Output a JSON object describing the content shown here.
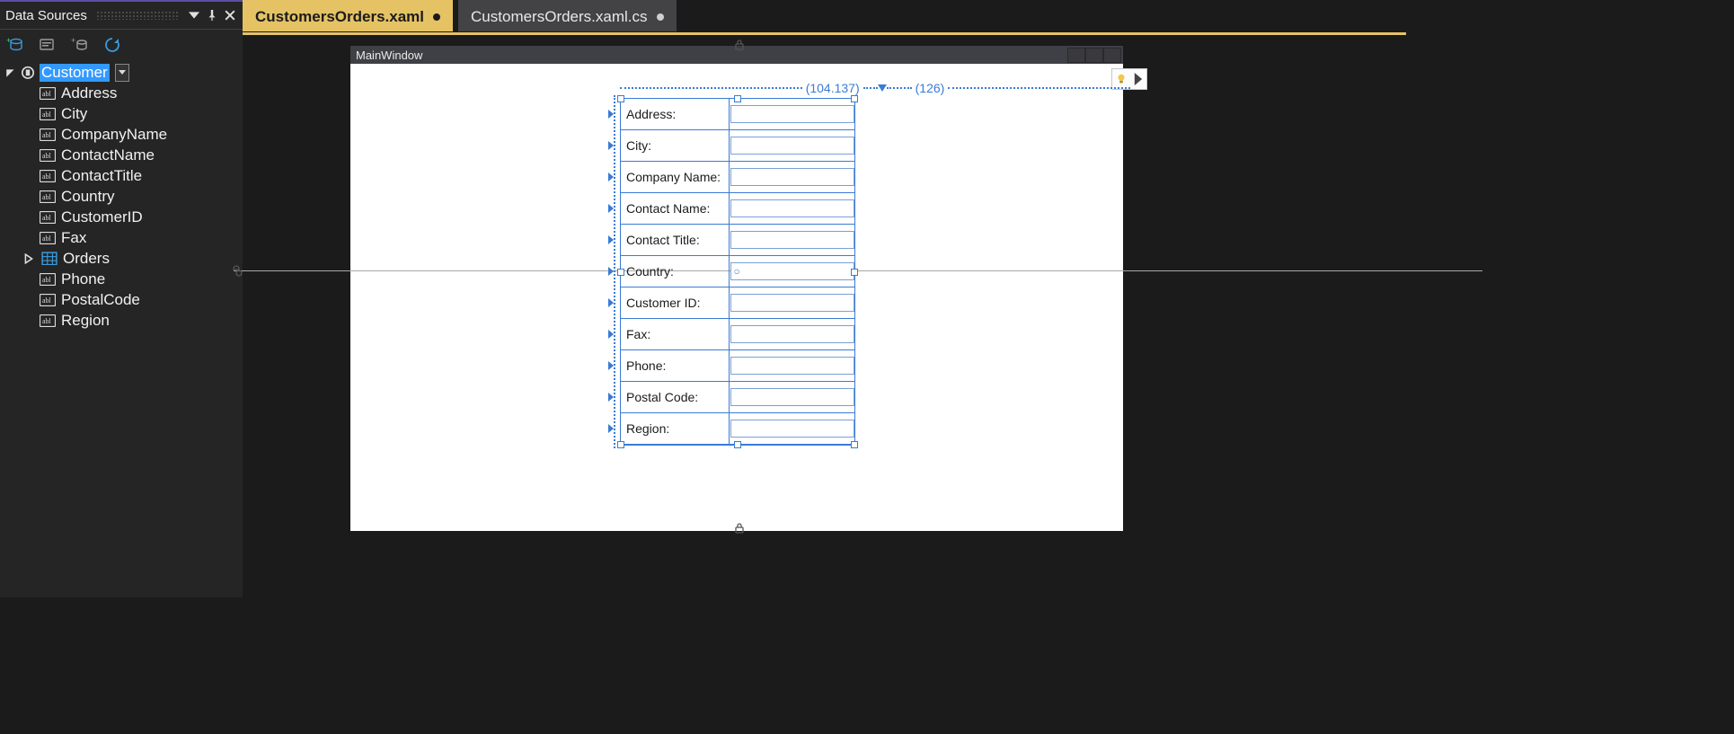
{
  "sidebar": {
    "title": "Data Sources",
    "toolbar": [
      "add-new-source",
      "edit",
      "add-query",
      "refresh"
    ],
    "root": {
      "label": "Customer",
      "children": [
        {
          "kind": "field",
          "label": "Address"
        },
        {
          "kind": "field",
          "label": "City"
        },
        {
          "kind": "field",
          "label": "CompanyName"
        },
        {
          "kind": "field",
          "label": "ContactName"
        },
        {
          "kind": "field",
          "label": "ContactTitle"
        },
        {
          "kind": "field",
          "label": "Country"
        },
        {
          "kind": "field",
          "label": "CustomerID"
        },
        {
          "kind": "field",
          "label": "Fax"
        },
        {
          "kind": "grid",
          "label": "Orders",
          "expandable": true
        },
        {
          "kind": "field",
          "label": "Phone"
        },
        {
          "kind": "field",
          "label": "PostalCode"
        },
        {
          "kind": "field",
          "label": "Region"
        }
      ]
    }
  },
  "tabs": [
    {
      "label": "CustomersOrders.xaml",
      "active": true,
      "dirty": true
    },
    {
      "label": "CustomersOrders.xaml.cs",
      "active": false,
      "dirty": true
    }
  ],
  "designer": {
    "windowTitle": "MainWindow",
    "ruler": {
      "col0": "(104.137)",
      "col1": "(126)"
    },
    "formRows": [
      {
        "label": "Address:",
        "value": ""
      },
      {
        "label": "City:",
        "value": ""
      },
      {
        "label": "Company Name:",
        "value": ""
      },
      {
        "label": "Contact Name:",
        "value": ""
      },
      {
        "label": "Contact Title:",
        "value": ""
      },
      {
        "label": "Country:",
        "value": "○"
      },
      {
        "label": "Customer ID:",
        "value": ""
      },
      {
        "label": "Fax:",
        "value": ""
      },
      {
        "label": "Phone:",
        "value": ""
      },
      {
        "label": "Postal Code:",
        "value": ""
      },
      {
        "label": "Region:",
        "value": ""
      }
    ]
  }
}
